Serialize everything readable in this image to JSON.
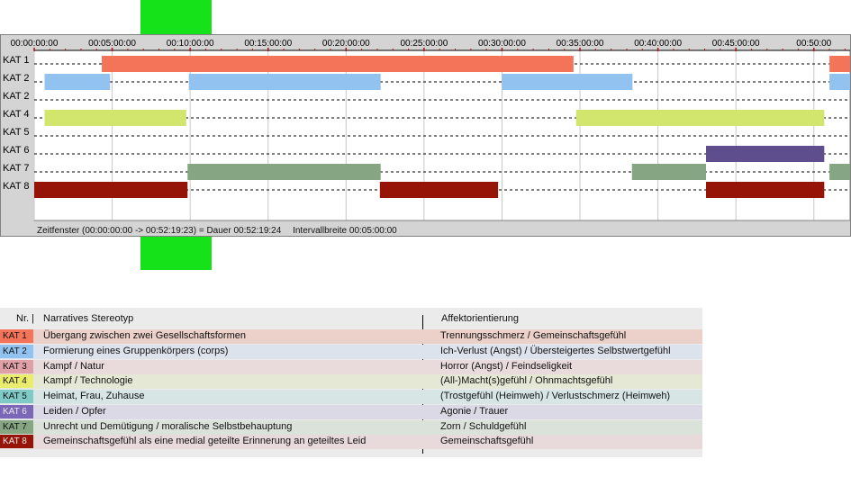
{
  "chart_data": {
    "type": "gantt",
    "time_axis": {
      "ticks": [
        "00:00:00:00",
        "00:05:00:00",
        "00:10:00:00",
        "00:15:00:00",
        "00:20:00:00",
        "00:25:00:00",
        "00:30:00:00",
        "00:35:00:00",
        "00:40:00:00",
        "00:45:00:00",
        "00:50:00"
      ],
      "range_seconds": [
        0,
        3139.4
      ],
      "interval_seconds": 300
    },
    "rows": [
      {
        "label": "KAT 1",
        "color": "#f37458",
        "intervals": [
          [
            260,
            2075
          ],
          [
            3060,
            3140
          ]
        ]
      },
      {
        "label": "KAT 2",
        "color": "#92c2f0",
        "intervals": [
          [
            40,
            292
          ],
          [
            595,
            1333
          ],
          [
            1800,
            2302
          ],
          [
            3060,
            3140
          ]
        ]
      },
      {
        "label": "KAT 2",
        "color": "#e0a0a8",
        "intervals": []
      },
      {
        "label": "KAT 4",
        "color": "#d2e56c",
        "intervals": [
          [
            40,
            585
          ],
          [
            2085,
            3040
          ]
        ]
      },
      {
        "label": "KAT 5",
        "color": "#7fc9c6",
        "intervals": []
      },
      {
        "label": "KAT 6",
        "color": "#5e4e8e",
        "intervals": [
          [
            2585,
            3040
          ]
        ]
      },
      {
        "label": "KAT 7",
        "color": "#85a583",
        "intervals": [
          [
            590,
            1333
          ],
          [
            2300,
            2585
          ],
          [
            3060,
            3140
          ]
        ]
      },
      {
        "label": "KAT 8",
        "color": "#961308",
        "intervals": [
          [
            0,
            590
          ],
          [
            1330,
            1785
          ],
          [
            2585,
            3040
          ]
        ]
      }
    ]
  },
  "status": {
    "zeitfenster": "Zeitfenster (00:00:00:00 -> 00:52:19:23) = Dauer 00:52:19:24",
    "intervallbreite": "Intervallbreite 00:05:00:00"
  },
  "legend": {
    "header": {
      "nr": "Nr. |",
      "stereotyp": "Narratives Stereotyp",
      "affekt": "Affektorientierung"
    },
    "rows": [
      {
        "nr": "KAT 1",
        "color": "#f37458",
        "bg": "#ecd1cb",
        "stereotyp": "Übergang zwischen zwei Gesellschaftsformen",
        "affekt": "Trennungsschmerz / Gemeinschaftsgefühl"
      },
      {
        "nr": "KAT 2",
        "color": "#92c2f0",
        "bg": "#dde3ec",
        "stereotyp": "Formierung eines Gruppenkörpers (corps)",
        "affekt": "Ich-Verlust (Angst) / Übersteigertes Selbstwertgefühl"
      },
      {
        "nr": "KAT 3",
        "color": "#e0a0a8",
        "bg": "#e9dadc",
        "stereotyp": "Kampf / Natur",
        "affekt": "Horror (Angst) / Feindseligkeit"
      },
      {
        "nr": "KAT 4",
        "color": "#eaec6e",
        "bg": "#e6e8d6",
        "stereotyp": "Kampf / Technologie",
        "affekt": "(All-)Macht(s)gefühl / Ohnmachtsgefühl"
      },
      {
        "nr": "KAT 5",
        "color": "#7fc9c6",
        "bg": "#d7e6e5",
        "stereotyp": "Heimat, Frau, Zuhause",
        "affekt": "(Trostgefühl (Heimweh) / Verlustschmerz (Heimweh)"
      },
      {
        "nr": "KAT 6",
        "color": "#7b67b8",
        "bg": "#dcd9e6",
        "stereotyp": "Leiden / Opfer",
        "affekt": "Agonie / Trauer"
      },
      {
        "nr": "KAT 7",
        "color": "#85a583",
        "bg": "#dbe2da",
        "stereotyp": "Unrecht und Demütigung / moralische Selbstbehauptung",
        "affekt": "Zorn / Schuldgefühl"
      },
      {
        "nr": "KAT 8",
        "color": "#961308",
        "bg": "#e8d9da",
        "stereotyp": "Gemeinschaftsgefühl als eine medial geteilte Erinnerung an geteiltes Leid",
        "affekt": "Gemeinschaftsgefühl"
      }
    ]
  }
}
